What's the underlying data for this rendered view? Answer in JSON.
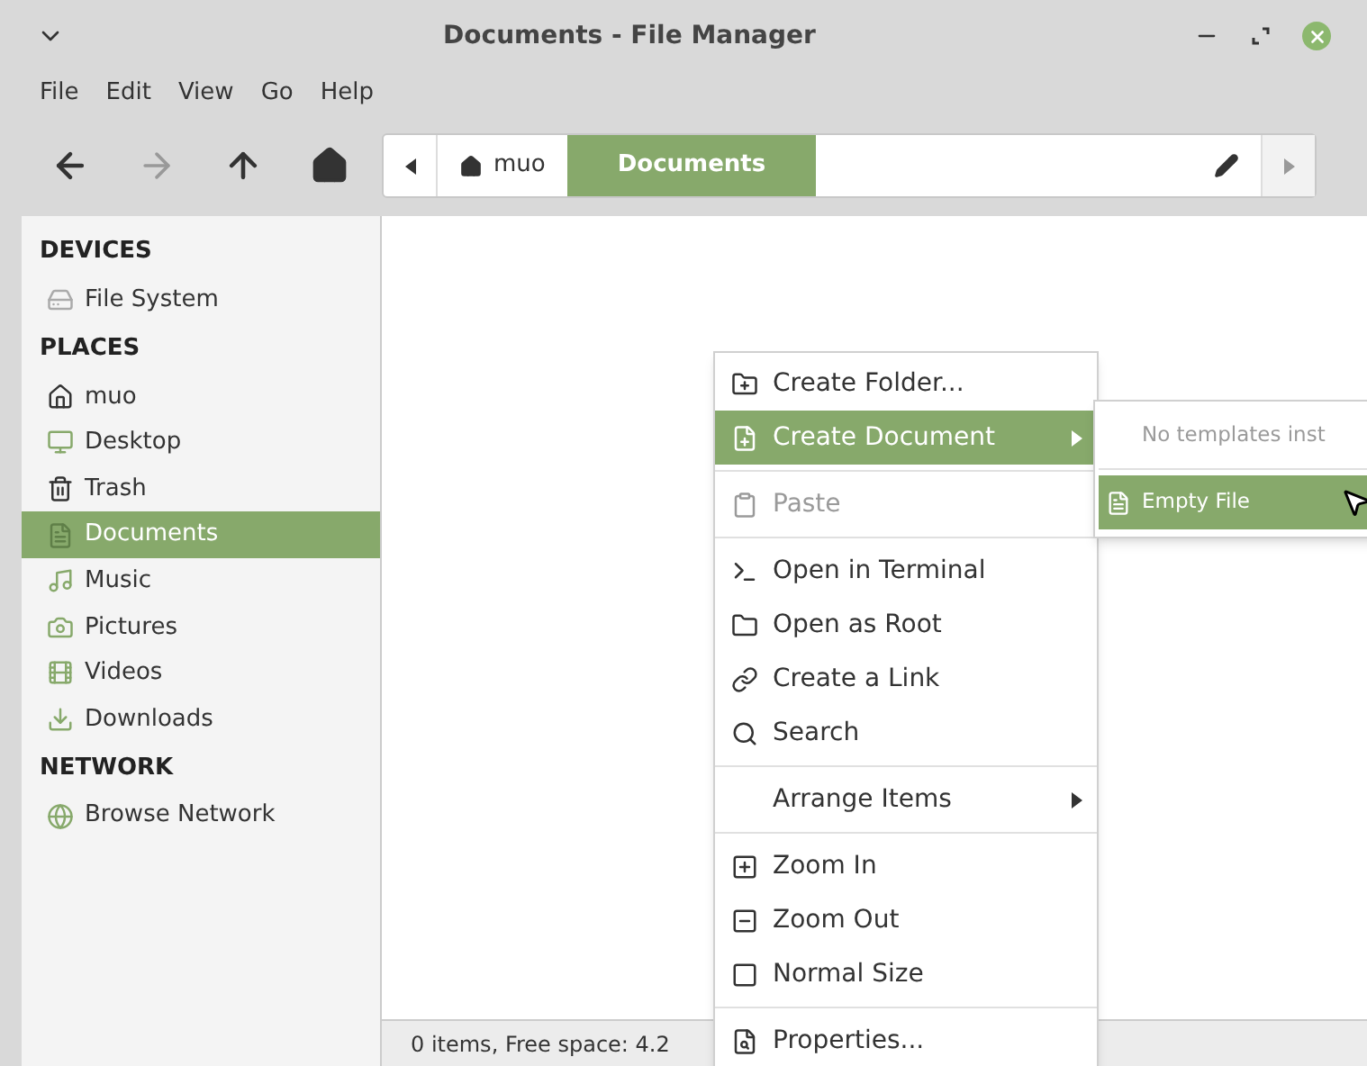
{
  "window": {
    "title": "Documents - File Manager"
  },
  "menu_bar": [
    "File",
    "Edit",
    "View",
    "Go",
    "Help"
  ],
  "path_bar": [
    {
      "label": "muo",
      "selected": false
    },
    {
      "label": "Documents",
      "selected": true
    }
  ],
  "sidebar": [
    {
      "heading": "DEVICES",
      "items": [
        {
          "label": "File System",
          "selected": false
        }
      ]
    },
    {
      "heading": "PLACES",
      "items": [
        {
          "label": "muo",
          "selected": false
        },
        {
          "label": "Desktop",
          "selected": false
        },
        {
          "label": "Trash",
          "selected": false
        },
        {
          "label": "Documents",
          "selected": true
        },
        {
          "label": "Music",
          "selected": false
        },
        {
          "label": "Pictures",
          "selected": false
        },
        {
          "label": "Videos",
          "selected": false
        },
        {
          "label": "Downloads",
          "selected": false
        }
      ]
    },
    {
      "heading": "NETWORK",
      "items": [
        {
          "label": "Browse Network",
          "selected": false
        }
      ]
    }
  ],
  "status_bar": "0 items, Free space: 4.2",
  "context_menu": [
    {
      "kind": "item",
      "label": "Create Folder...",
      "selected": false,
      "disabled": false
    },
    {
      "kind": "submenu",
      "label": "Create Document",
      "selected": true,
      "disabled": false
    },
    {
      "kind": "separator"
    },
    {
      "kind": "item",
      "label": "Paste",
      "selected": false,
      "disabled": true
    },
    {
      "kind": "separator"
    },
    {
      "kind": "item",
      "label": "Open in Terminal",
      "selected": false,
      "disabled": false
    },
    {
      "kind": "item",
      "label": "Open as Root",
      "selected": false,
      "disabled": false
    },
    {
      "kind": "item",
      "label": "Create a Link",
      "selected": false,
      "disabled": false
    },
    {
      "kind": "item",
      "label": "Search",
      "selected": false,
      "disabled": false
    },
    {
      "kind": "separator"
    },
    {
      "kind": "submenu",
      "label": "Arrange Items",
      "selected": false,
      "disabled": false
    },
    {
      "kind": "separator"
    },
    {
      "kind": "item",
      "label": "Zoom In",
      "selected": false,
      "disabled": false
    },
    {
      "kind": "item",
      "label": "Zoom Out",
      "selected": false,
      "disabled": false
    },
    {
      "kind": "item",
      "label": "Normal Size",
      "selected": false,
      "disabled": false
    },
    {
      "kind": "separator"
    },
    {
      "kind": "item",
      "label": "Properties...",
      "selected": false,
      "disabled": false
    }
  ],
  "submenu": [
    {
      "kind": "item",
      "label": "No templates inst",
      "selected": false,
      "disabled": true
    },
    {
      "kind": "separator"
    },
    {
      "kind": "item",
      "label": "Empty File",
      "selected": true,
      "disabled": false
    }
  ]
}
